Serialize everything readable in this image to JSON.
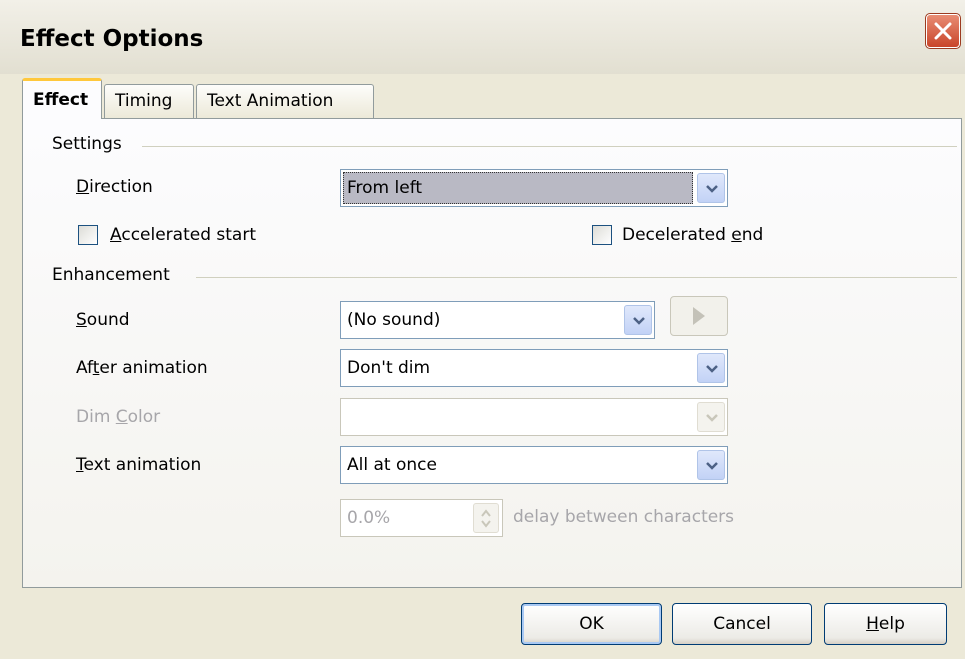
{
  "window": {
    "title": "Effect Options"
  },
  "tabs": [
    {
      "label": "Effect",
      "active": true
    },
    {
      "label": "Timing",
      "active": false
    },
    {
      "label": "Text Animation",
      "active": false
    }
  ],
  "settings": {
    "group_label": "Settings",
    "direction_label_pre": "",
    "direction_label_u": "D",
    "direction_label_post": "irection",
    "direction_value": "From left",
    "accelerated_u": "A",
    "accelerated_post": "ccelerated start",
    "accelerated_checked": false,
    "decelerated_pre": "Decelerated ",
    "decelerated_u": "e",
    "decelerated_post": "nd",
    "decelerated_checked": false
  },
  "enhancement": {
    "group_label": "Enhancement",
    "sound_u": "S",
    "sound_post": "ound",
    "sound_value": "(No sound)",
    "after_pre": "Af",
    "after_u": "t",
    "after_post": "er animation",
    "after_value": "Don't dim",
    "dim_pre": "Dim ",
    "dim_u": "C",
    "dim_post": "olor",
    "dim_value": "",
    "text_u": "T",
    "text_post": "ext animation",
    "text_value": "All at once",
    "delay_value": "0.0%",
    "delay_label": "delay between characters"
  },
  "buttons": {
    "ok": "OK",
    "cancel": "Cancel",
    "help_u": "H",
    "help_post": "elp"
  }
}
